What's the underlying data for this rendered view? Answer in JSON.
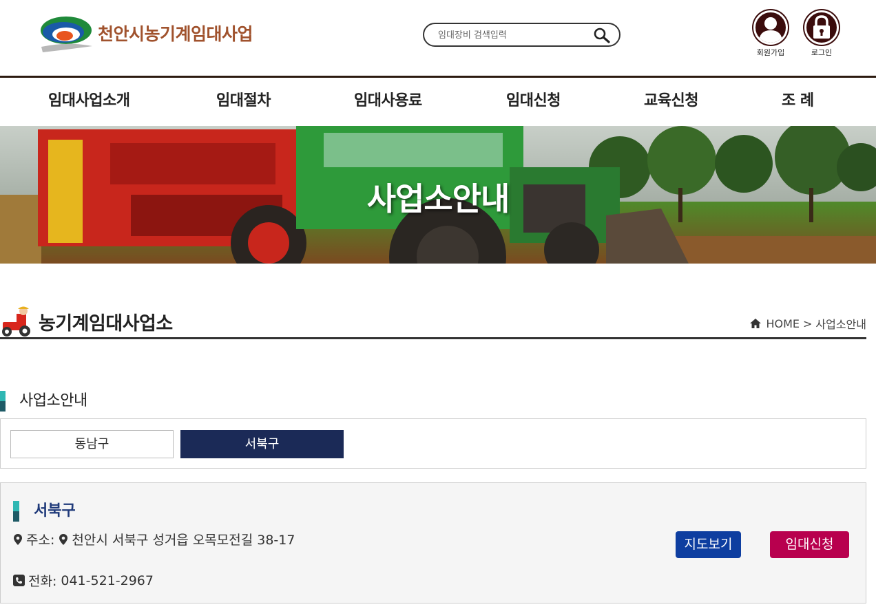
{
  "header": {
    "site_title": "천안시농기계임대사업",
    "search_placeholder": "임대장비 검색입력",
    "signup_label": "회원가입",
    "login_label": "로그인"
  },
  "nav": {
    "items": [
      "임대사업소개",
      "임대절차",
      "임대사용료",
      "임대신청",
      "교육신청",
      "조 례"
    ]
  },
  "banner": {
    "title": "사업소안내"
  },
  "page": {
    "title": "농기계임대사업소",
    "breadcrumb_home": "HOME",
    "breadcrumb_sep": ">",
    "breadcrumb_current": "사업소안내"
  },
  "section": {
    "title": "사업소안내",
    "tabs": [
      {
        "label": "동남구",
        "active": false
      },
      {
        "label": "서북구",
        "active": true
      }
    ]
  },
  "office": {
    "name": "서북구",
    "address_label": "주소:",
    "address": "천안시 서북구 성거읍 오목모전길 38-17",
    "phone_label": "전화:",
    "phone": "041-521-2967",
    "map_button": "지도보기",
    "apply_button": "임대신청"
  },
  "colors": {
    "nav_text": "#222222",
    "logo_text": "#a0522d",
    "active_tab": "#1b2a57",
    "map_button": "#0e3ea0",
    "apply_button": "#b8004e",
    "accent_teal": "#2fb7b3",
    "accent_dark": "#1e5a66"
  }
}
